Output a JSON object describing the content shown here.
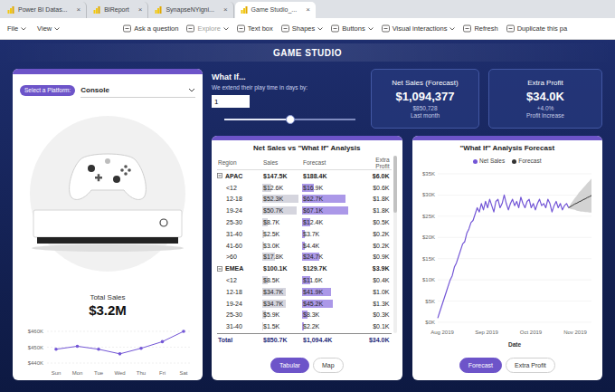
{
  "browser_tabs": [
    {
      "label": "Power BI Datas...",
      "close": "×",
      "selected": false
    },
    {
      "label": "BIReport",
      "close": "×",
      "selected": false
    },
    {
      "label": "SynapseNYigni...",
      "close": "×",
      "selected": false
    },
    {
      "label": "Game Studio_...",
      "close": "×",
      "selected": true
    }
  ],
  "toolbar": {
    "menus": [
      {
        "label": "File",
        "dropdown": true
      },
      {
        "label": "View",
        "dropdown": true
      }
    ],
    "actions": [
      {
        "label": "Ask a question",
        "dropdown": false,
        "disabled": false
      },
      {
        "label": "Explore",
        "dropdown": true,
        "disabled": true
      },
      {
        "label": "Text box",
        "dropdown": false,
        "disabled": false
      },
      {
        "label": "Shapes",
        "dropdown": true,
        "disabled": false
      },
      {
        "label": "Buttons",
        "dropdown": true,
        "disabled": false
      },
      {
        "label": "Visual interactions",
        "dropdown": true,
        "disabled": false
      },
      {
        "label": "Refresh",
        "dropdown": false,
        "disabled": false
      },
      {
        "label": "Duplicate this pa",
        "dropdown": false,
        "disabled": false
      }
    ]
  },
  "report": {
    "title": "GAME STUDIO",
    "platform": {
      "label": "Select a Platform:",
      "value": "Console"
    },
    "total_sales": {
      "label": "Total Sales",
      "value": "$3.2M",
      "chart": {
        "y_ticks": [
          "$460K",
          "$450K",
          "$440K"
        ],
        "x_labels": [
          "Sun",
          "Mon",
          "Tue",
          "Wed",
          "Thu",
          "Fri",
          "Sat"
        ],
        "values": [
          448.7,
          450.6,
          448.7,
          445.8,
          449.3,
          453.5,
          460
        ]
      }
    },
    "what_if": {
      "title": "What If...",
      "caption": "We extend their play time in days by:",
      "value": "1",
      "level": 0.5
    },
    "kpis": [
      {
        "title": "Net Sales (Forecast)",
        "value": "$1,094,377",
        "sub": "$850,728",
        "note": "Last month"
      },
      {
        "title": "Extra Profit",
        "value": "$34.0K",
        "sub": "+4.0%",
        "note": "Profit Increase"
      }
    ],
    "table": {
      "title": "Net Sales vs \"What If\" Analysis",
      "columns": [
        "Region",
        "Sales",
        "Forecast",
        "Extra Profit"
      ],
      "groups": [
        {
          "label": "APAC",
          "expanded": true,
          "sales": "$147.5K",
          "forecast": "$188.4K",
          "extra": "$6.0K",
          "rows": [
            {
              "label": "<12",
              "sales": "$12.6K",
              "forecast": "$16.9K",
              "extra": "$0.6K",
              "sales_level": 0.24,
              "forecast_level": 0.25
            },
            {
              "label": "12-18",
              "sales": "$52.3K",
              "forecast": "$62.7K",
              "extra": "$1.8K",
              "sales_level": 0.99,
              "forecast_level": 0.92
            },
            {
              "label": "19-24",
              "sales": "$50.7K",
              "forecast": "$67.1K",
              "extra": "$1.8K",
              "sales_level": 0.96,
              "forecast_level": 0.99
            },
            {
              "label": "25-30",
              "sales": "$8.7K",
              "forecast": "$12.4K",
              "extra": "$0.5K",
              "sales_level": 0.16,
              "forecast_level": 0.18
            },
            {
              "label": "31-40",
              "sales": "$2.5K",
              "forecast": "$3.7K",
              "extra": "$0.2K",
              "sales_level": 0.05,
              "forecast_level": 0.05
            },
            {
              "label": "41-60",
              "sales": "$3.0K",
              "forecast": "$4.4K",
              "extra": "$0.2K",
              "sales_level": 0.06,
              "forecast_level": 0.06
            },
            {
              "label": ">60",
              "sales": "$17.8K",
              "forecast": "$24.7K",
              "extra": "$0.9K",
              "sales_level": 0.34,
              "forecast_level": 0.36
            }
          ]
        },
        {
          "label": "EMEA",
          "expanded": true,
          "sales": "$100.1K",
          "forecast": "$129.7K",
          "extra": "$3.9K",
          "rows": [
            {
              "label": "<12",
              "sales": "$8.5K",
              "forecast": "$11.6K",
              "extra": "$0.4K",
              "sales_level": 0.16,
              "forecast_level": 0.17
            },
            {
              "label": "12-18",
              "sales": "$34.7K",
              "forecast": "$41.9K",
              "extra": "$1.0K",
              "sales_level": 0.65,
              "forecast_level": 0.62
            },
            {
              "label": "19-24",
              "sales": "$34.7K",
              "forecast": "$45.2K",
              "extra": "$1.3K",
              "sales_level": 0.65,
              "forecast_level": 0.66
            },
            {
              "label": "25-30",
              "sales": "$5.9K",
              "forecast": "$8.3K",
              "extra": "$0.3K",
              "sales_level": 0.11,
              "forecast_level": 0.12
            },
            {
              "label": "31-40",
              "sales": "$1.5K",
              "forecast": "$2.2K",
              "extra": "$0.1K",
              "sales_level": 0.03,
              "forecast_level": 0.03
            }
          ]
        }
      ],
      "total": {
        "label": "Total",
        "sales": "$850.7K",
        "forecast": "$1,094.4K",
        "extra": "$34.0K"
      },
      "scroll": {
        "level": 0.32
      },
      "views": [
        {
          "label": "Tabular",
          "selected": true
        },
        {
          "label": "Map",
          "selected": false
        }
      ]
    },
    "forecast_chart": {
      "title": "\"What If\" Analysis Forecast",
      "series": [
        {
          "label": "Net Sales",
          "color": "#7356d6",
          "values": [
            1,
            2.5,
            4,
            5.5,
            7,
            8.5,
            10,
            11,
            13,
            14,
            15.5,
            17,
            18.5,
            19,
            21,
            22,
            23.5,
            24,
            25.5,
            27,
            26,
            28,
            26.5,
            28.5,
            27,
            29,
            27.5,
            26,
            28.5,
            29,
            27,
            28,
            30,
            28,
            26.5,
            28,
            29,
            27.5,
            28.5,
            27,
            29.5,
            28,
            27,
            28.5,
            29,
            27,
            28,
            26.5,
            28,
            29,
            27.5,
            28,
            27,
            29,
            28,
            26,
            27.5,
            28.5,
            27,
            28,
            26.5,
            27.5,
            28,
            27
          ]
        },
        {
          "label": "Forecast",
          "color": "#333333",
          "values": [
            27.3,
            27.6,
            27.9,
            28.1,
            28.4,
            28.6,
            28.9,
            29.1,
            29.4,
            29.6,
            29.9
          ],
          "lower": [
            26.7,
            26.6,
            26.5,
            26.3,
            26.2,
            26.1,
            26.1,
            26.0,
            26.0,
            25.9,
            25.9
          ],
          "upper": [
            27.9,
            28.6,
            29.3,
            29.9,
            30.6,
            31.1,
            31.7,
            32.2,
            32.8,
            33.3,
            33.9
          ]
        }
      ],
      "y_ticks": [
        "$35K",
        "$30K",
        "$25K",
        "$20K",
        "$15K",
        "$10K",
        "$5K",
        "$0K"
      ],
      "x_ticks": [
        "Aug 2019",
        "Sep 2019",
        "Oct 2019",
        "Nov 2019"
      ],
      "x_title": "Date",
      "views": [
        {
          "label": "Forecast",
          "selected": true
        },
        {
          "label": "Extra Profit",
          "selected": false
        }
      ]
    }
  }
}
